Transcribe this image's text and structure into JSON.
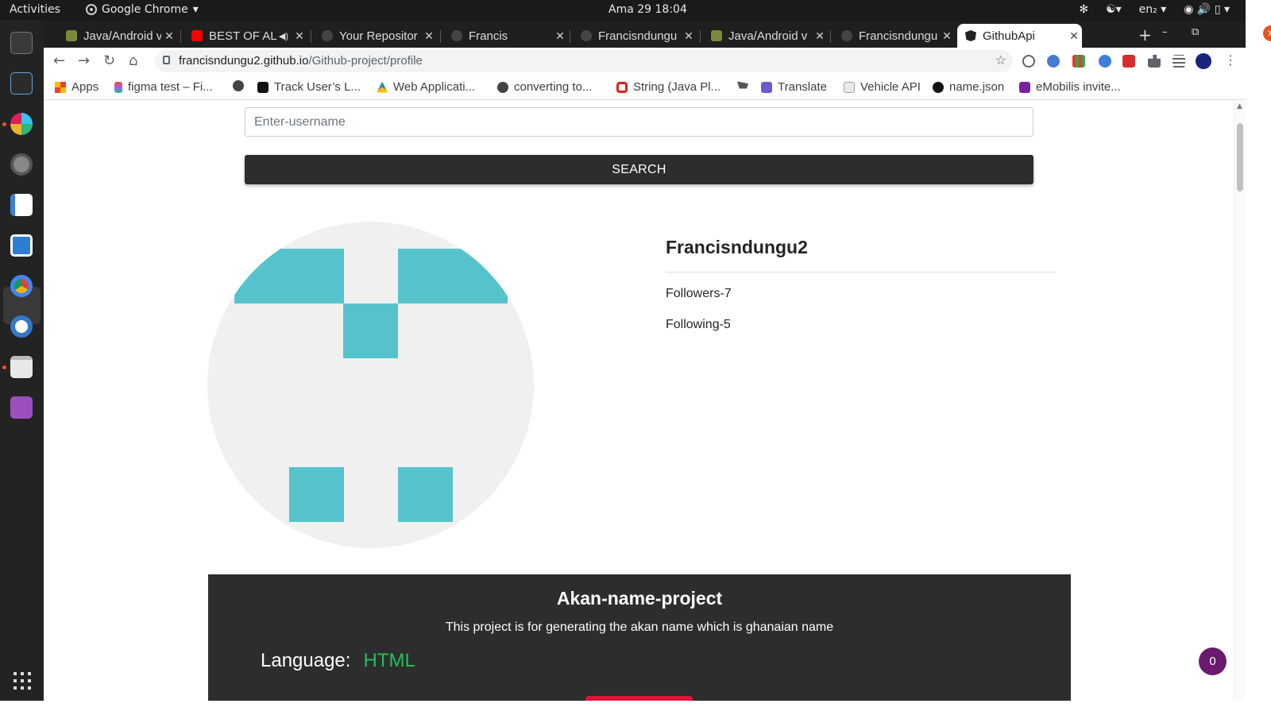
{
  "system": {
    "activities": "Activities",
    "app_name": "Google Chrome",
    "clock": "Ama 29  18:04",
    "language": "en₂"
  },
  "tabs": [
    {
      "title": "Java/Android v",
      "favicon_color": "#7a8a3a"
    },
    {
      "title": "BEST OF AL",
      "favicon_color": "#ff0000"
    },
    {
      "title": "Your Repositor",
      "favicon_color": "#444444"
    },
    {
      "title": "Francis",
      "favicon_color": "#444444"
    },
    {
      "title": "Francisndungu",
      "favicon_color": "#444444"
    },
    {
      "title": "Java/Android v",
      "favicon_color": "#7a8a3a"
    },
    {
      "title": "Francisndungu",
      "favicon_color": "#444444"
    },
    {
      "title": "GithubApi",
      "favicon_color": "#222222",
      "active": true
    }
  ],
  "address": {
    "host": "francisndungu2.github.io",
    "path": "/Github-project/profile"
  },
  "bookmarks": [
    {
      "label": "Apps",
      "icon": "apps-grid-icon",
      "color": "#e94235"
    },
    {
      "label": "figma test – Fi...",
      "icon": "figma-icon",
      "color": "#f24e1e"
    },
    {
      "label": "",
      "icon": "globe-icon",
      "color": "#444444"
    },
    {
      "label": "Track User’s L...",
      "icon": "medium-icon",
      "color": "#111111"
    },
    {
      "label": "Web Applicati...",
      "icon": "drive-icon",
      "color": "#0f9d58"
    },
    {
      "label": "converting to...",
      "icon": "globe-icon",
      "color": "#444444"
    },
    {
      "label": "String (Java Pl...",
      "icon": "oracle-icon",
      "color": "#e0201c"
    },
    {
      "label": "",
      "icon": "cart-icon",
      "color": "#555555"
    },
    {
      "label": "Translate",
      "icon": "translate-icon",
      "color": "#6a5acd"
    },
    {
      "label": "Vehicle API",
      "icon": "doc-icon",
      "color": "#9aa0a6"
    },
    {
      "label": "name.json",
      "icon": "github-icon",
      "color": "#111111"
    },
    {
      "label": "eMobilis invite...",
      "icon": "form-icon",
      "color": "#7b1fa2"
    }
  ],
  "search": {
    "placeholder": "Enter-username",
    "button_label": "SEARCH"
  },
  "profile": {
    "username": "Francisndungu2",
    "followers": "Followers-7",
    "following": "Following-5",
    "identicon_color": "#56c3cc",
    "identicon_bg": "#f0f0f0"
  },
  "repo": {
    "name": "Akan-name-project",
    "description": "This project is for generating the akan name which is ghanaian name",
    "language_label": "Language:",
    "language_value": "HTML",
    "language_color": "#1fc15c",
    "button_color": "#dc143c"
  },
  "notification_badge": "0"
}
